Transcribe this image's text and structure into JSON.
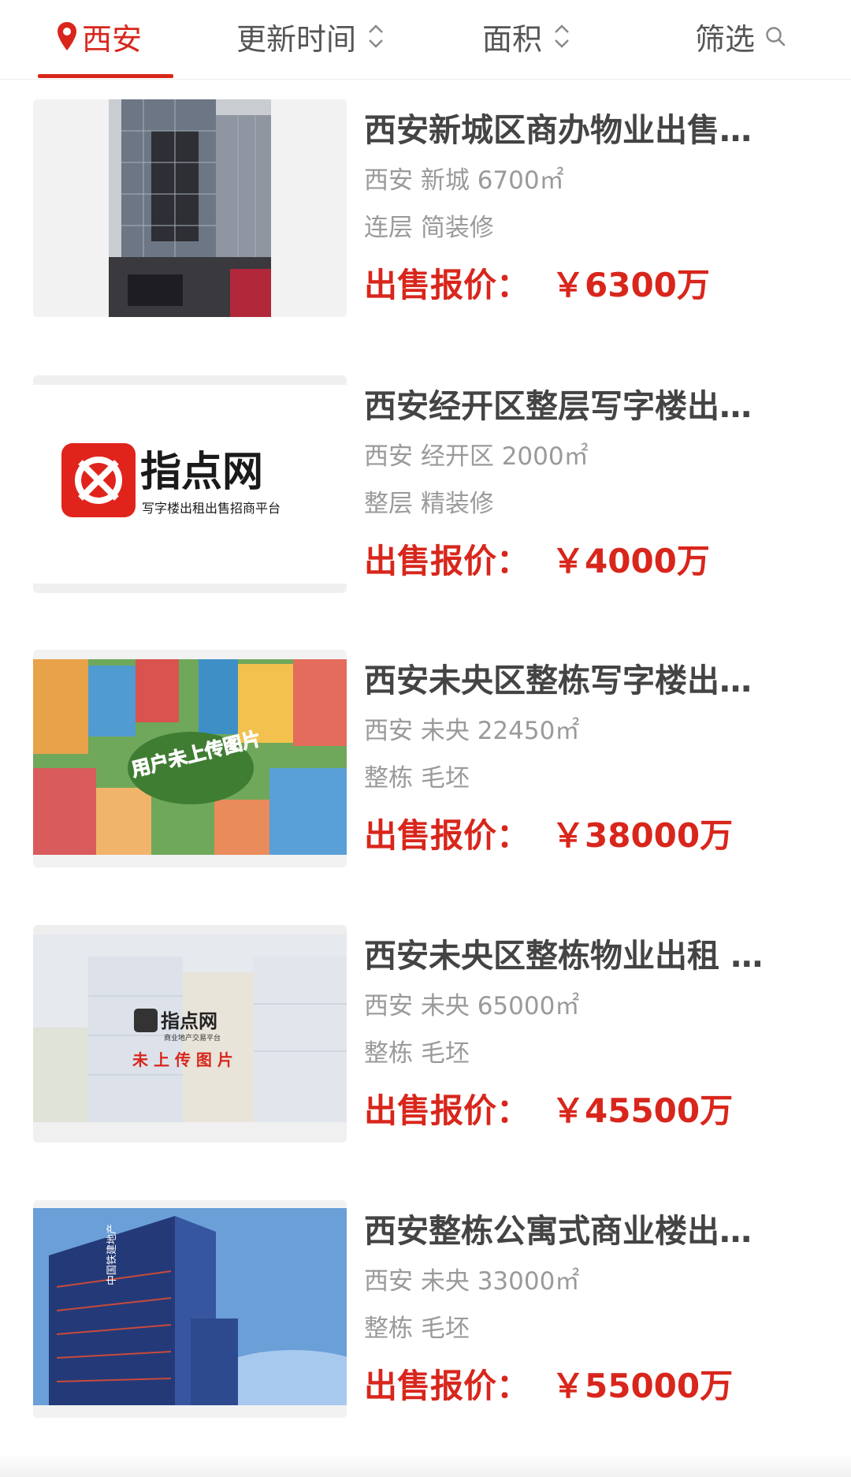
{
  "filter_bar": {
    "city": "西安",
    "update_time": "更新时间",
    "area": "面积",
    "filter": "筛选"
  },
  "colors": {
    "accent": "#d8261c",
    "title": "#444444",
    "meta": "#9a9a9a"
  },
  "listings": [
    {
      "title": "西安新城区商办物业出售…",
      "meta": "西安 新城 6700㎡",
      "tags": "连层 简装修",
      "price_label": "出售报价：",
      "price": "￥6300万",
      "image": "office-tower-photo"
    },
    {
      "title": "西安经开区整层写字楼出…",
      "meta": "西安 经开区 2000㎡",
      "tags": "整层 精装修",
      "price_label": "出售报价：",
      "price": "￥4000万",
      "image": "zhidianwang-logo",
      "logo_text": "指点网",
      "logo_subtitle": "写字楼出租出售招商平台"
    },
    {
      "title": "西安未央区整栋写字楼出…",
      "meta": "西安 未央 22450㎡",
      "tags": "整栋 毛坯",
      "price_label": "出售报价：",
      "price": "￥38000万",
      "image": "placeholder-town-illustration",
      "overlay_text": "用户未上传图片"
    },
    {
      "title": "西安未央区整栋物业出租 …",
      "meta": "西安 未央 65000㎡",
      "tags": "整栋 毛坯",
      "price_label": "出售报价：",
      "price": "￥45500万",
      "image": "placeholder-faded-buildings",
      "logo_text": "指点网",
      "logo_subtitle": "商业地产交易平台",
      "overlay_text": "未 上 传 图 片"
    },
    {
      "title": "西安整栋公寓式商业楼出…",
      "meta": "西安 未央 33000㎡",
      "tags": "整栋 毛坯",
      "price_label": "出售报价：",
      "price": "￥55000万",
      "image": "crcc-tower-photo",
      "sign_text": "中国铁建地产"
    }
  ]
}
